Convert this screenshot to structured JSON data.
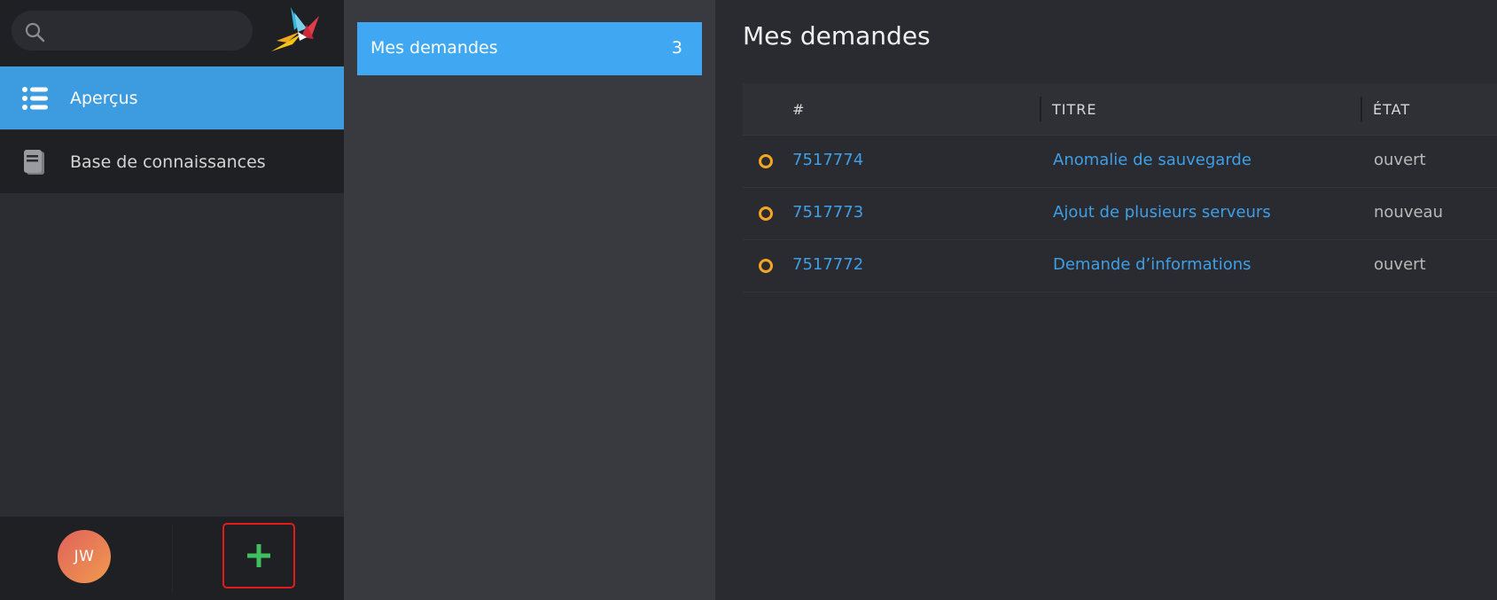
{
  "search": {
    "placeholder": "",
    "value": ""
  },
  "sidebar": {
    "items": [
      {
        "label": "Aperçus",
        "icon": "list-icon",
        "active": true
      },
      {
        "label": "Base de connaissances",
        "icon": "book-icon",
        "active": false
      }
    ],
    "avatar_initials": "JW",
    "add_icon": "plus-icon"
  },
  "queue": {
    "label": "Mes demandes",
    "count": "3"
  },
  "main": {
    "title": "Mes demandes",
    "columns": [
      "#",
      "TITRE",
      "ÉTAT"
    ],
    "rows": [
      {
        "number": "7517774",
        "title": "Anomalie de sauvegarde",
        "state": "ouvert"
      },
      {
        "number": "7517773",
        "title": "Ajout de plusieurs serveurs",
        "state": "nouveau"
      },
      {
        "number": "7517772",
        "title": "Demande d’informations",
        "state": "ouvert"
      }
    ]
  },
  "colors": {
    "accent": "#40a8f3",
    "active_nav": "#3d9be0",
    "link": "#3e9fe6",
    "status_open": "#f5a623",
    "add_green": "#3fbf5f",
    "highlight_border": "#e31b1b"
  }
}
